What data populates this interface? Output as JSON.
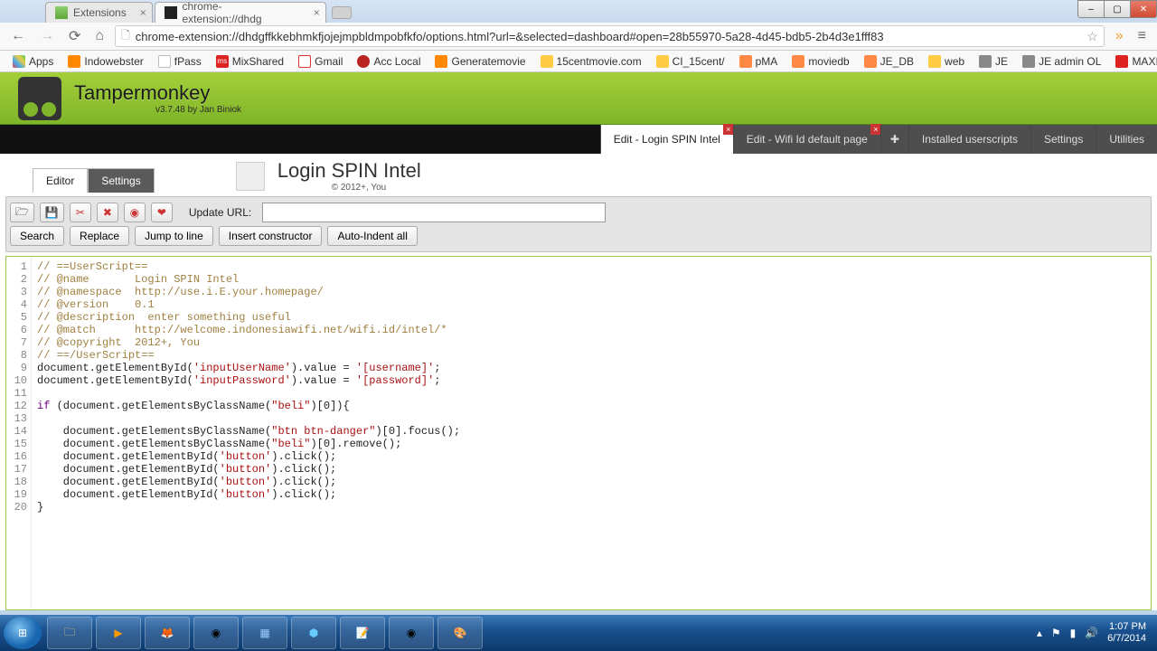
{
  "window": {
    "tabs": [
      {
        "title": "Extensions"
      },
      {
        "title": "chrome-extension://dhdg"
      }
    ],
    "url": "chrome-extension://dhdgffkkebhmkfjojejmpbldmpobfkfo/options.html?url=&selected=dashboard#open=28b55970-5a28-4d45-bdb5-2b4d3e1fff83"
  },
  "bookmarks": [
    "Apps",
    "Indowebster",
    "fPass",
    "MixShared",
    "Gmail",
    "Acc Local",
    "Generatemovie",
    "15centmovie.com",
    "CI_15cent/",
    "pMA",
    "moviedb",
    "JE_DB",
    "web",
    "JE",
    "JE admin OL",
    "MAXI"
  ],
  "tm": {
    "title": "Tampermonkey",
    "version": "v3.7.48 by Jan Biniok",
    "nav": {
      "edit1": "Edit - Login SPIN Intel",
      "edit2": "Edit - Wifi Id default page",
      "installed": "Installed userscripts",
      "settings": "Settings",
      "utilities": "Utilities"
    }
  },
  "script": {
    "title": "Login SPIN Intel",
    "copy": "© 2012+, You",
    "subtabs": {
      "editor": "Editor",
      "settings": "Settings"
    },
    "toolbar": {
      "update_label": "Update URL:",
      "search": "Search",
      "replace": "Replace",
      "jump": "Jump to line",
      "insert": "Insert constructor",
      "autoindent": "Auto-Indent all"
    }
  },
  "code": {
    "lines": [
      "// ==UserScript==",
      "// @name       Login SPIN Intel",
      "// @namespace  http://use.i.E.your.homepage/",
      "// @version    0.1",
      "// @description  enter something useful",
      "// @match      http://welcome.indonesiawifi.net/wifi.id/intel/*",
      "// @copyright  2012+, You",
      "// ==/UserScript=="
    ],
    "input_user": "inputUserName",
    "input_pass": "inputPassword",
    "val_user": "[username]",
    "val_pass": "[password]",
    "beli": "beli",
    "btn_danger": "btn btn-danger",
    "button": "button"
  },
  "taskbar": {
    "time": "1:07 PM",
    "date": "6/7/2014"
  }
}
